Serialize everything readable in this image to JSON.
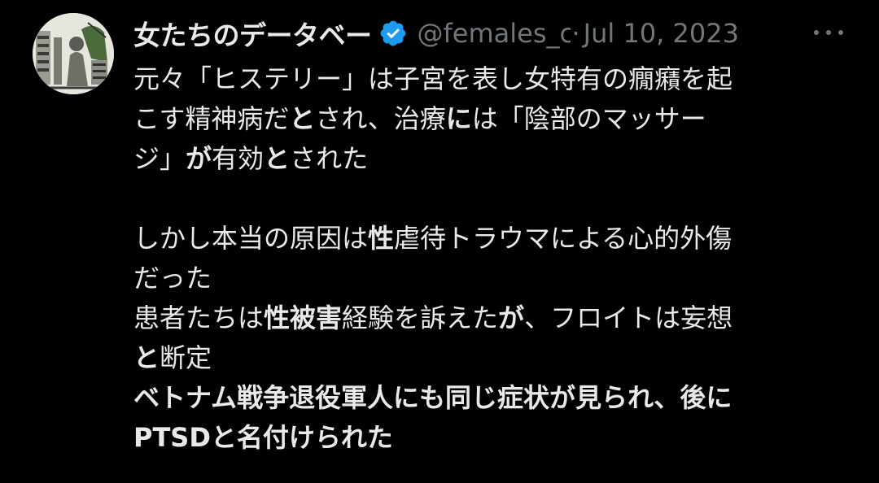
{
  "tweet": {
    "author": {
      "display_name": "女たちのデータベー",
      "verified_icon": "verified-badge-icon",
      "handle": "@females_c",
      "avatar": "avatar-illustration"
    },
    "separator": "·",
    "date": "Jul 10, 2023",
    "more_icon": "more-horizontal-icon",
    "body": {
      "l1": "元々「ヒステリー」は子宮を表し女特有の癇癪を起",
      "l2a": "こす精神病だ",
      "l2b": "と",
      "l2c": "され、治療",
      "l2d": "に",
      "l2e": "は「陰部のマッサー",
      "l3a": "ジ」",
      "l3b": "が",
      "l3c": "有効",
      "l3d": "と",
      "l3e": "された",
      "l5a": "しかし本当の原因は",
      "l5b": "性",
      "l5c": "虐待トラウマによる心的外傷",
      "l6": "だった",
      "l7a": "患者たちは",
      "l7b": "性被害",
      "l7c": "経験を訴えた",
      "l7d": "が",
      "l7e": "、フロイトは妄想",
      "l8a": "と",
      "l8b": "断定",
      "l9": "ベトナム戦争退役軍人にも同じ症状が見られ、後に",
      "l10": "PTSDと名付けられた"
    }
  },
  "colors": {
    "background": "#000000",
    "text": "#e7e9ea",
    "secondary": "#71767b",
    "verified": "#1d9bf0"
  }
}
